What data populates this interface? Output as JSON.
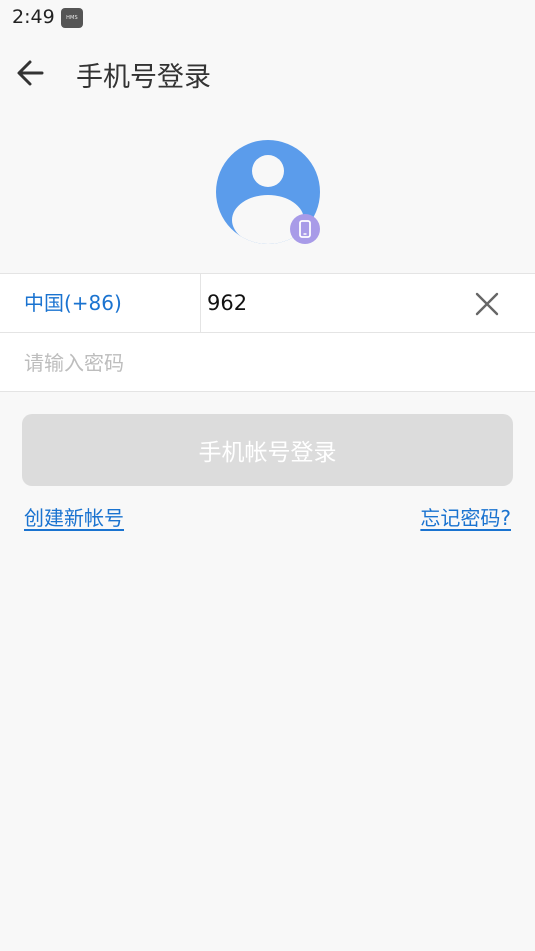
{
  "status_bar": {
    "time": "2:49",
    "badge": "HMS"
  },
  "header": {
    "title": "手机号登录"
  },
  "form": {
    "country_code": "中国(+86)",
    "phone_value": "962",
    "password_placeholder": "请输入密码"
  },
  "actions": {
    "login_label": "手机帐号登录",
    "create_account": "创建新帐号",
    "forgot_password": "忘记密码?"
  },
  "colors": {
    "accent": "#1a73d0",
    "avatar": "#5b9ceb",
    "phone_badge": "#a89be8",
    "button_disabled": "#dcdcdc"
  },
  "icons": [
    "back-arrow-icon",
    "avatar-icon",
    "phone-icon",
    "close-icon"
  ]
}
